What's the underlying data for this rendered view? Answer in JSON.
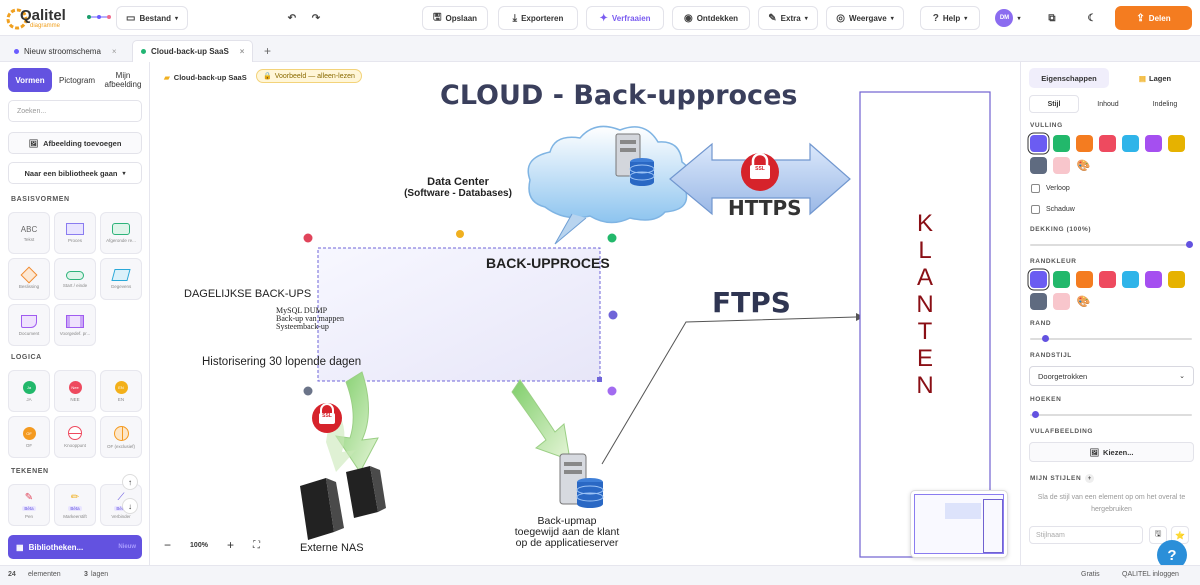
{
  "app": {
    "logo_text": "Qalitel",
    "logo_sub": "diagramme"
  },
  "toolbar": {
    "file": "Bestand",
    "save": "Opslaan",
    "export": "Exporteren",
    "ask": "Verfraaien",
    "discover": "Ontdekken",
    "extra": "Extra",
    "view": "Weergave",
    "help": "Help",
    "avatar": "DM",
    "share": "Delen"
  },
  "tabs": [
    {
      "label": "Nieuw stroomschema",
      "color": "#6a5cff"
    },
    {
      "label": "Cloud-back-up SaaS",
      "color": "#22b573"
    }
  ],
  "sidebar": {
    "tabs": [
      "Vormen",
      "Pictogram",
      "Mijn afbeelding"
    ],
    "search_placeholder": "Zoeken...",
    "add_image": "Afbeelding toevoegen",
    "goto_library": "Naar een bibliotheek gaan",
    "sections": {
      "basic": "BASISVORMEN",
      "logic": "LOGICA",
      "draw": "TEKENEN"
    },
    "basic_shapes": [
      "Tekst",
      "Proces",
      "Afgeronde re...",
      "Beslissing",
      "Start / einde",
      "Gegevens",
      "Document",
      "Voorgedef. pr..."
    ],
    "basic_text": "ABC",
    "logic_shapes": [
      "JA",
      "NEE",
      "EN",
      "OF",
      "Knooppunt",
      "OF (exclusief)"
    ],
    "logic_marks": [
      "Ja",
      "Nee",
      "EN",
      "OF"
    ],
    "draw_shapes": [
      "Pen",
      "Markeerstift",
      "Verbinder"
    ],
    "draw_tag": "Bèta",
    "library_button": "Bibliotheken...",
    "library_badge": "Nieuw"
  },
  "canvas": {
    "breadcrumb": "Cloud-back-up SaaS",
    "readonly_badge": "Voorbeeld — alleen-lezen",
    "title": "CLOUD - Back-upproces",
    "data_center": "Data Center",
    "data_center_sub": "(Software - Databases)",
    "https": "HTTPS",
    "ssl": "SSL",
    "back_upproces": "BACK-UPPROCES",
    "daily": "DAGELIJKSE BACK-UPS",
    "mysql_lines": [
      "MySQL DUMP",
      "Back-up van mappen",
      "Systeemback-up"
    ],
    "history": "Historisering 30 lopende dagen",
    "ftps": "FTPS",
    "clients_letters": [
      "K",
      "L",
      "A",
      "N",
      "T",
      "E",
      "N"
    ],
    "external_nas": "Externe NAS",
    "backup_lines": [
      "Back-upmap",
      "toegewijd aan de klant",
      "op de applicatieserver"
    ],
    "zoom": "100%"
  },
  "right_panel": {
    "tabs": [
      "Eigenschappen",
      "Lagen"
    ],
    "subtabs": [
      "Stijl",
      "Inhoud",
      "Indeling"
    ],
    "fill_label": "VULLING",
    "fill_colors": [
      "#6b5cf2",
      "#22b86b",
      "#f47c20",
      "#ee4a5f",
      "#2fb4e9",
      "#a54ff0",
      "#e6b200",
      "#5f6b80",
      "#f8c6cc"
    ],
    "gradient": "Verloop",
    "shadow": "Schaduw",
    "opacity_label": "DEKKING (100%)",
    "border_color_label": "RANDKLEUR",
    "border_label": "RAND",
    "border_style_label": "RANDSTIJL",
    "border_style": "Doorgetrokken",
    "corners_label": "HOEKEN",
    "fill_image_label": "VULAFBEELDING",
    "choose": "Kiezen...",
    "my_styles": "MIJN STIJLEN",
    "my_styles_hint": "Sla de stijl van een element op om het overal te hergebruiken",
    "style_name_placeholder": "Stijlnaam"
  },
  "status": {
    "elements_count": "24",
    "elements_label": "elementen",
    "layers_count": "3",
    "layers_label": "lagen",
    "plan": "Gratis",
    "login": "QALITEL inloggen"
  }
}
